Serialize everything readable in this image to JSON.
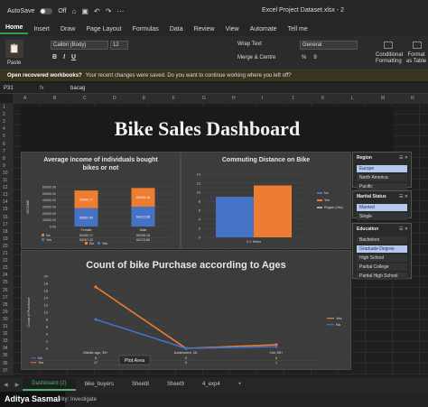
{
  "titlebar": {
    "autosave_label": "AutoSave",
    "autosave_state": "Off",
    "file_title": "Excel Project Dataset.xlsx - 2"
  },
  "menu_tabs": [
    "Home",
    "Insert",
    "Draw",
    "Page Layout",
    "Formulas",
    "Data",
    "Review",
    "View",
    "Automate",
    "Tell me"
  ],
  "ribbon": {
    "paste": "Paste",
    "font_name": "Calibri (Body)",
    "font_size": "12",
    "format_buttons": [
      "B",
      "I",
      "U"
    ],
    "wrap_text": "Wrap Text",
    "merge_centre": "Merge & Centre",
    "number_format": "General",
    "number_buttons": [
      "%",
      "9"
    ],
    "conditional_formatting": "Conditional Formatting",
    "format_as_table": "Format as Table"
  },
  "notification": {
    "title": "Open recovered workbooks?",
    "message": "Your recent changes were saved. Do you want to continue working where you left off?"
  },
  "formula_bar": {
    "cell": "P31",
    "fx": "fx",
    "value": "bacag"
  },
  "columns": [
    "A",
    "B",
    "C",
    "D",
    "E",
    "F",
    "G",
    "H",
    "I",
    "J",
    "K",
    "L",
    "M",
    "N"
  ],
  "rows": [
    "1",
    "2",
    "3",
    "4",
    "5",
    "6",
    "7",
    "8",
    "9",
    "10",
    "11",
    "12",
    "13",
    "14",
    "15",
    "16",
    "17",
    "18",
    "19",
    "20",
    "21",
    "22",
    "23",
    "24",
    "25",
    "26",
    "27",
    "28",
    "29",
    "30",
    "31",
    "32",
    "33",
    "34",
    "35",
    "36",
    "37"
  ],
  "dashboard": {
    "title": "Bike Sales Dashboard"
  },
  "chart_data": [
    {
      "type": "bar",
      "title": "Average income of individuals bought bikes or not",
      "ylabel": "INCOME",
      "ylim": [
        0,
        60000
      ],
      "yticks": [
        "60000.00",
        "50000.00",
        "40000.00",
        "30000.00",
        "20000.00",
        "10000.00",
        "0.00"
      ],
      "categories": [
        "Female",
        "Male"
      ],
      "series": [
        {
          "name": "No",
          "values": [
            53440.17,
            56208.18
          ],
          "color": "#ef7d31"
        },
        {
          "name": "Yes",
          "values": [
            55267.42,
            60123.88
          ],
          "color": "#4472c4"
        }
      ],
      "data_labels": [
        "53440.17",
        "55267.42",
        "56208.18",
        "60123.88"
      ],
      "table_rows": [
        {
          "label": "No",
          "values": [
            "53440.17",
            "56208.18"
          ]
        },
        {
          "label": "Yes",
          "values": [
            "55267.42",
            "60123.88"
          ]
        }
      ],
      "legend": [
        "No",
        "Yes"
      ],
      "legend_title": "Purchased Bike"
    },
    {
      "type": "bar",
      "title": "Commuting Distance on Bike",
      "ylim": [
        0,
        14
      ],
      "yticks": [
        "14",
        "12",
        "10",
        "8",
        "6",
        "4",
        "2",
        "0"
      ],
      "categories": [
        "0-1 Miles"
      ],
      "series": [
        {
          "name": "No",
          "values": [
            9
          ],
          "color": "#4472c4"
        },
        {
          "name": "Yes",
          "values": [
            11.5
          ],
          "color": "#ef7d31"
        }
      ],
      "legend": [
        "No",
        "Yes",
        "Region (Yes)"
      ]
    },
    {
      "type": "line",
      "title": "Count of bike Purchase according to Ages",
      "ylabel": "Count of Purchase",
      "ylim": [
        0,
        20
      ],
      "yticks": [
        "20",
        "18",
        "16",
        "14",
        "12",
        "10",
        "8",
        "6",
        "4",
        "2",
        "0"
      ],
      "categories": [
        "Middle age, 35+",
        "Adolescent, 25-",
        "Old, 55+"
      ],
      "series": [
        {
          "name": "Yes",
          "values": [
            17,
            0,
            1
          ],
          "color": "#ef7d31"
        },
        {
          "name": "No",
          "values": [
            8,
            0,
            0.5
          ],
          "color": "#4472c4"
        }
      ],
      "table_rows": [
        {
          "label": "No",
          "values": [
            "8",
            "0",
            "0"
          ]
        },
        {
          "label": "Yes",
          "values": [
            "17",
            "0",
            "1"
          ]
        }
      ],
      "plot_area_label": "Plot Area"
    }
  ],
  "slicers": {
    "region": {
      "title": "Region",
      "items": [
        {
          "label": "Europe",
          "selected": true
        },
        {
          "label": "North America",
          "selected": false
        },
        {
          "label": "Pacific",
          "selected": false
        }
      ]
    },
    "marital": {
      "title": "Marital Status",
      "items": [
        {
          "label": "Married",
          "selected": true
        },
        {
          "label": "Single",
          "selected": false
        }
      ]
    },
    "education": {
      "title": "Education",
      "items": [
        {
          "label": "Bachelors",
          "selected": false
        },
        {
          "label": "Graduate Degree",
          "selected": true
        },
        {
          "label": "High School",
          "selected": false
        },
        {
          "label": "Partial College",
          "selected": false
        },
        {
          "label": "Partial High School",
          "selected": false
        }
      ]
    }
  },
  "sheet_tabs": [
    {
      "label": "Dashboard (2)",
      "active": true
    },
    {
      "label": "bike_buyers",
      "active": false
    },
    {
      "label": "Sheet8",
      "active": false
    },
    {
      "label": "Sheet9",
      "active": false
    },
    {
      "label": "4_exp4",
      "active": false
    }
  ],
  "add_sheet": "+",
  "status": {
    "user": "Aditya Sasmal",
    "accessibility": "ility: Investigate"
  }
}
